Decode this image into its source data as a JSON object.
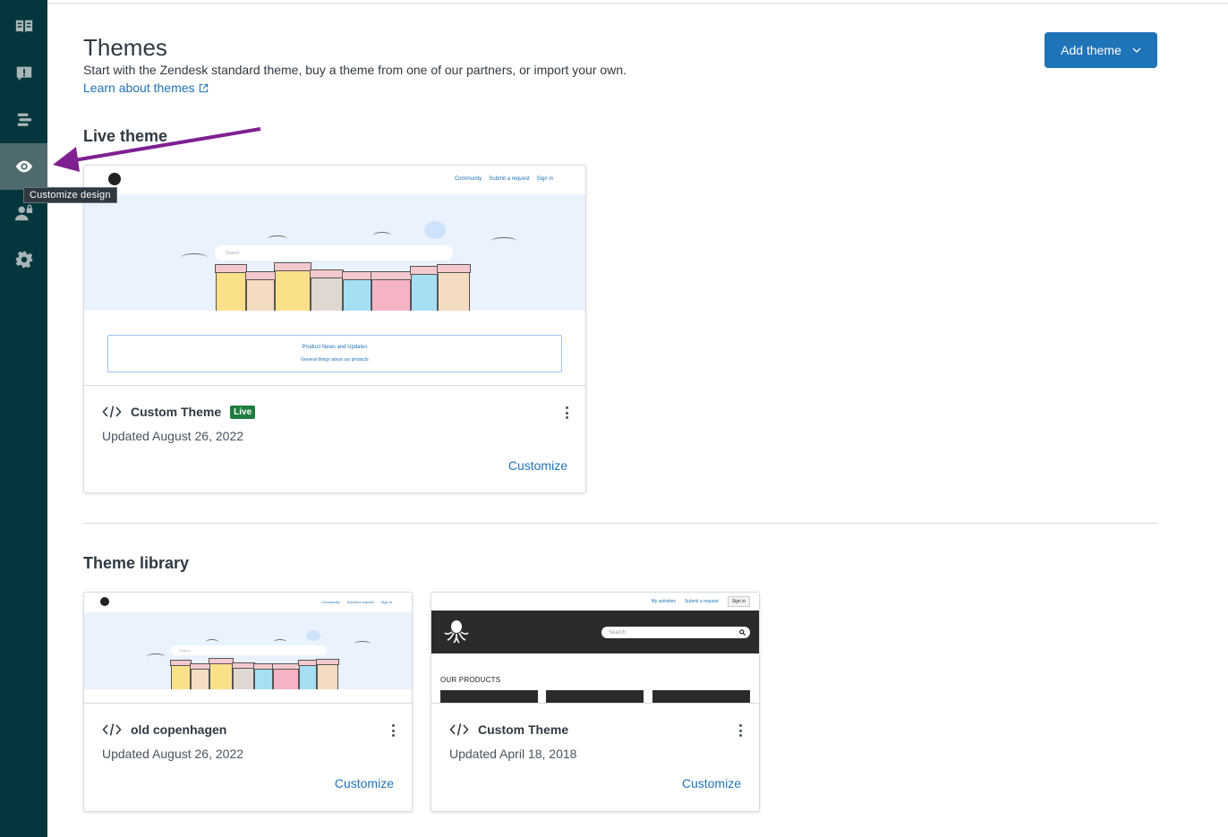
{
  "sidebar": {
    "items": [
      {
        "name": "guide-icon",
        "label": "Guide"
      },
      {
        "name": "feedback-icon",
        "label": "Feedback"
      },
      {
        "name": "organize-icon",
        "label": "Organize"
      },
      {
        "name": "customize-design-icon",
        "label": "Customize design",
        "active": true
      },
      {
        "name": "user-permissions-icon",
        "label": "User permissions"
      },
      {
        "name": "settings-icon",
        "label": "Settings"
      }
    ],
    "tooltip": "Customize design"
  },
  "header": {
    "title": "Themes",
    "description": "Start with the Zendesk standard theme, buy a theme from one of our partners, or import your own.",
    "learn_link": "Learn about themes",
    "add_button": "Add theme"
  },
  "live_section": {
    "title": "Live theme",
    "card": {
      "name": "Custom Theme",
      "badge": "Live",
      "updated": "Updated August 26, 2022",
      "action": "Customize",
      "preview": {
        "links": [
          "Community",
          "Submit a request",
          "Sign in"
        ],
        "search_placeholder": "Search",
        "category_title": "Product News and Updates",
        "category_desc": "General things about our products"
      }
    }
  },
  "library_section": {
    "title": "Theme library",
    "cards": [
      {
        "name": "old copenhagen",
        "updated": "Updated August 26, 2022",
        "action": "Customize",
        "preview": {
          "links": [
            "Community",
            "Submit a request",
            "Sign in"
          ],
          "search_placeholder": "Search"
        }
      },
      {
        "name": "Custom Theme",
        "updated": "Updated April 18, 2018",
        "action": "Customize",
        "preview": {
          "links": [
            "My activities",
            "Submit a request"
          ],
          "sign_in": "Sign in",
          "search_placeholder": "Search",
          "section_heading": "OUR PRODUCTS"
        }
      }
    ]
  },
  "colors": {
    "sidebar_bg": "#03363d",
    "sidebar_active": "#4f6a6e",
    "accent": "#1f73b7",
    "live_badge": "#1e7d3f",
    "annotation_arrow": "#7f2190"
  }
}
